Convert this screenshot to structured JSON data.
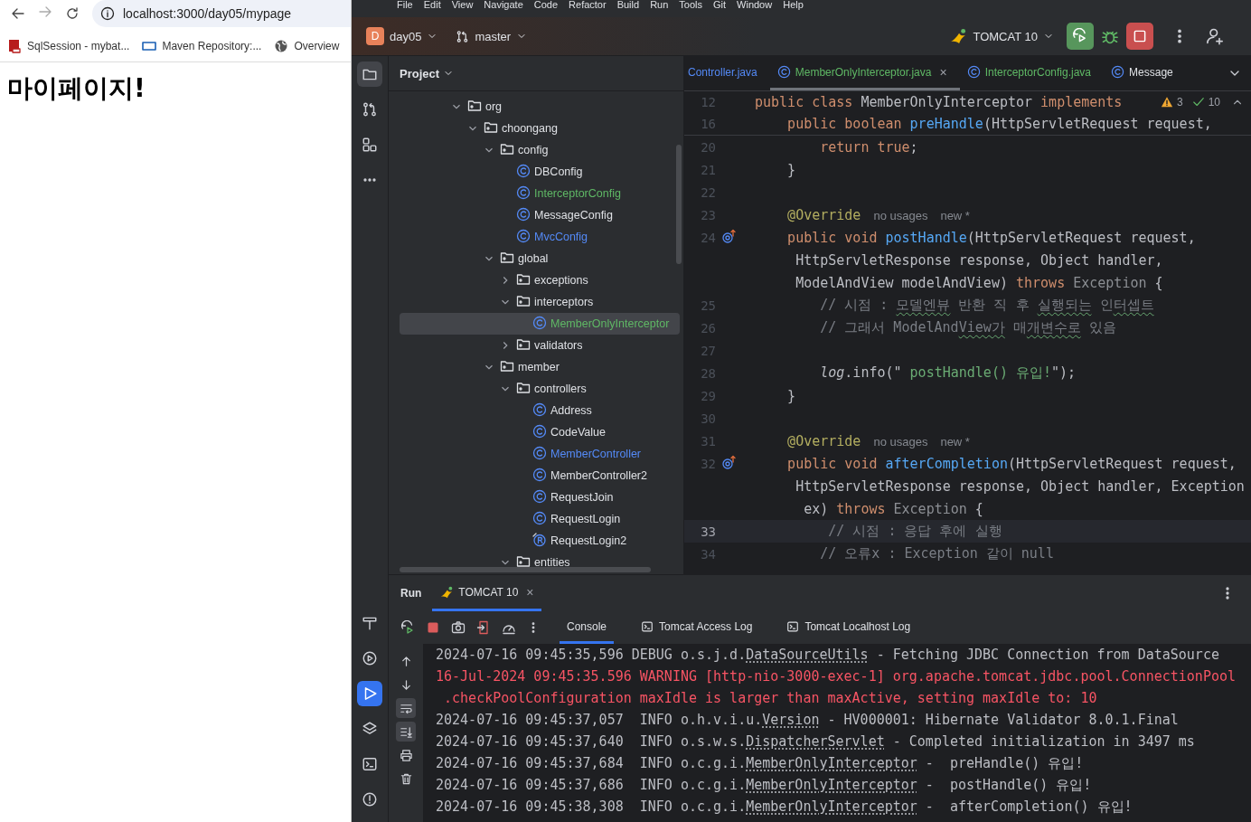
{
  "browser": {
    "url": "localhost:3000/day05/mypage",
    "bookmarks": [
      {
        "label": "SqlSession - mybat...",
        "kind": "book"
      },
      {
        "label": "Maven Repository:...",
        "kind": "maven"
      },
      {
        "label": "Overview",
        "kind": "globe"
      }
    ],
    "page_heading": "마이페이지!"
  },
  "ide": {
    "menu": [
      "File",
      "Edit",
      "View",
      "Navigate",
      "Code",
      "Refactor",
      "Build",
      "Run",
      "Tools",
      "Git",
      "Window",
      "Help"
    ],
    "toolbar": {
      "project_initial": "D",
      "project": "day05",
      "branch": "master",
      "run_config": "TOMCAT 10"
    },
    "tool_strip_top": [
      {
        "kind": "folder",
        "selected": true
      },
      {
        "kind": "pull-request",
        "selected": false
      },
      {
        "kind": "structure",
        "selected": false
      },
      {
        "kind": "more",
        "selected": false
      }
    ],
    "tool_strip_bottom": [
      {
        "kind": "build",
        "selected": false
      },
      {
        "kind": "services",
        "selected": false
      },
      {
        "kind": "run",
        "selected": true
      },
      {
        "kind": "layers",
        "selected": false
      },
      {
        "kind": "terminal",
        "selected": false
      },
      {
        "kind": "problems",
        "selected": false
      }
    ],
    "project_panel": {
      "title": "Project",
      "tree": [
        {
          "label": "org",
          "kind": "folder",
          "expanded": true,
          "selected": false,
          "color": "#dfe1e5",
          "children": [
            {
              "label": "choongang",
              "kind": "folder",
              "expanded": true,
              "selected": false,
              "color": "#dfe1e5",
              "children": [
                {
                  "label": "config",
                  "kind": "folder",
                  "expanded": true,
                  "selected": false,
                  "color": "#dfe1e5",
                  "children": [
                    {
                      "label": "DBConfig",
                      "kind": "class",
                      "selected": false,
                      "color": "#dfe1e5"
                    },
                    {
                      "label": "InterceptorConfig",
                      "kind": "class",
                      "selected": false,
                      "color": "#5fb865"
                    },
                    {
                      "label": "MessageConfig",
                      "kind": "class",
                      "selected": false,
                      "color": "#dfe1e5"
                    },
                    {
                      "label": "MvcConfig",
                      "kind": "class",
                      "selected": false,
                      "color": "#548af7"
                    }
                  ]
                },
                {
                  "label": "global",
                  "kind": "folder",
                  "expanded": true,
                  "selected": false,
                  "color": "#dfe1e5",
                  "children": [
                    {
                      "label": "exceptions",
                      "kind": "folder",
                      "expanded": false,
                      "selected": false,
                      "color": "#dfe1e5"
                    },
                    {
                      "label": "interceptors",
                      "kind": "folder",
                      "expanded": true,
                      "selected": false,
                      "color": "#dfe1e5",
                      "children": [
                        {
                          "label": "MemberOnlyInterceptor",
                          "kind": "class",
                          "selected": true,
                          "color": "#5fb865"
                        }
                      ]
                    },
                    {
                      "label": "validators",
                      "kind": "folder",
                      "expanded": false,
                      "selected": false,
                      "color": "#dfe1e5"
                    }
                  ]
                },
                {
                  "label": "member",
                  "kind": "folder",
                  "expanded": true,
                  "selected": false,
                  "color": "#dfe1e5",
                  "children": [
                    {
                      "label": "controllers",
                      "kind": "folder",
                      "expanded": true,
                      "selected": false,
                      "color": "#dfe1e5",
                      "children": [
                        {
                          "label": "Address",
                          "kind": "class",
                          "selected": false,
                          "color": "#dfe1e5"
                        },
                        {
                          "label": "CodeValue",
                          "kind": "class",
                          "selected": false,
                          "color": "#dfe1e5"
                        },
                        {
                          "label": "MemberController",
                          "kind": "class",
                          "selected": false,
                          "color": "#548af7"
                        },
                        {
                          "label": "MemberController2",
                          "kind": "class",
                          "selected": false,
                          "color": "#dfe1e5"
                        },
                        {
                          "label": "RequestJoin",
                          "kind": "class",
                          "selected": false,
                          "color": "#dfe1e5"
                        },
                        {
                          "label": "RequestLogin",
                          "kind": "class",
                          "selected": false,
                          "color": "#dfe1e5"
                        },
                        {
                          "label": "RequestLogin2",
                          "kind": "record",
                          "selected": false,
                          "color": "#dfe1e5"
                        }
                      ]
                    },
                    {
                      "label": "entities",
                      "kind": "folder",
                      "expanded": true,
                      "selected": false,
                      "color": "#dfe1e5"
                    }
                  ]
                }
              ]
            }
          ]
        }
      ]
    },
    "editor": {
      "tabs": [
        {
          "label": "Controller.java",
          "selected": false,
          "color": "#548af7",
          "icon": false
        },
        {
          "label": "MemberOnlyInterceptor.java",
          "selected": true,
          "color": "#5fb865",
          "icon": true,
          "close_glyph": "×"
        },
        {
          "label": "InterceptorConfig.java",
          "selected": false,
          "color": "#5fb865",
          "icon": true
        },
        {
          "label": "Message",
          "selected": false,
          "color": "#dfe1e5",
          "icon": true
        }
      ],
      "inspections": {
        "warnings": "3",
        "checks": "10"
      },
      "lines": [
        {
          "number": "12",
          "sticky": true,
          "current": false,
          "marker": false,
          "tokens": [
            {
              "kind": "kw",
              "text": "public class "
            },
            {
              "kind": "plain",
              "text": "MemberOnlyInterceptor "
            },
            {
              "kind": "kw",
              "text": "implements"
            }
          ]
        },
        {
          "number": "16",
          "sticky": true,
          "current": false,
          "marker": false,
          "tokens": [
            {
              "kind": "kw",
              "text": "    public boolean "
            },
            {
              "kind": "fn",
              "text": "preHandle"
            },
            {
              "kind": "plain",
              "text": "(HttpServletRequest request,"
            }
          ]
        },
        {
          "number": "20",
          "sticky": false,
          "current": false,
          "marker": false,
          "tokens": [
            {
              "kind": "kw",
              "text": "        return true"
            },
            {
              "kind": "plain",
              "text": ";"
            }
          ]
        },
        {
          "number": "21",
          "sticky": false,
          "current": false,
          "marker": false,
          "tokens": [
            {
              "kind": "plain",
              "text": "    }"
            }
          ]
        },
        {
          "number": "22",
          "sticky": false,
          "current": false,
          "marker": false
        },
        {
          "number": "23",
          "sticky": false,
          "current": false,
          "marker": false,
          "tokens": [
            {
              "kind": "annot",
              "text": "    @Override"
            },
            {
              "kind": "hint",
              "text": "no usages"
            },
            {
              "kind": "hint",
              "text": "new *"
            }
          ]
        },
        {
          "number": "24",
          "sticky": false,
          "current": false,
          "marker": true,
          "tokens": [
            {
              "kind": "kw",
              "text": "    public void "
            },
            {
              "kind": "fn",
              "text": "postHandle"
            },
            {
              "kind": "plain",
              "text": "(HttpServletRequest request,"
            }
          ]
        },
        {
          "sticky": false,
          "current": false,
          "marker": false,
          "tokens": [
            {
              "kind": "plain",
              "text": "     HttpServletResponse response, Object handler,"
            }
          ]
        },
        {
          "sticky": false,
          "current": false,
          "marker": false,
          "tokens": [
            {
              "kind": "plain",
              "text": "     ModelAndView modelAndView) "
            },
            {
              "kind": "kw",
              "text": "throws "
            },
            {
              "kind": "dim",
              "text": "Exception "
            },
            {
              "kind": "plain",
              "text": "{"
            }
          ]
        },
        {
          "number": "25",
          "sticky": false,
          "current": false,
          "marker": false,
          "tokens": [
            {
              "kind": "comment",
              "text": "        // 시점 : "
            },
            {
              "kind": "typo",
              "text": "모델엔뷰"
            },
            {
              "kind": "comment",
              "text": " 반환 직 후 "
            },
            {
              "kind": "typo",
              "text": "실행되는"
            },
            {
              "kind": "comment",
              "text": " 인"
            },
            {
              "kind": "typo",
              "text": "터셉트"
            }
          ]
        },
        {
          "number": "26",
          "sticky": false,
          "current": false,
          "marker": false,
          "tokens": [
            {
              "kind": "comment",
              "text": "        // 그래서 ModelAnd"
            },
            {
              "kind": "typo",
              "text": "View가"
            },
            {
              "kind": "comment",
              "text": " 매"
            },
            {
              "kind": "typo",
              "text": "개변수로"
            },
            {
              "kind": "comment",
              "text": " 있음"
            }
          ]
        },
        {
          "number": "27",
          "sticky": false,
          "current": false,
          "marker": false
        },
        {
          "number": "28",
          "sticky": false,
          "current": false,
          "marker": false,
          "tokens": [
            {
              "kind": "static",
              "text": "        log"
            },
            {
              "kind": "plain",
              "text": ".info(\""
            },
            {
              "kind": "str",
              "text": " postHandle() 유입!"
            },
            {
              "kind": "plain",
              "text": "\");"
            }
          ]
        },
        {
          "number": "29",
          "sticky": false,
          "current": false,
          "marker": false,
          "tokens": [
            {
              "kind": "plain",
              "text": "    }"
            }
          ]
        },
        {
          "number": "30",
          "sticky": false,
          "current": false,
          "marker": false
        },
        {
          "number": "31",
          "sticky": false,
          "current": false,
          "marker": false,
          "tokens": [
            {
              "kind": "annot",
              "text": "    @Override"
            },
            {
              "kind": "hint",
              "text": "no usages"
            },
            {
              "kind": "hint",
              "text": "new *"
            }
          ]
        },
        {
          "number": "32",
          "sticky": false,
          "current": false,
          "marker": true,
          "tokens": [
            {
              "kind": "kw",
              "text": "    public void "
            },
            {
              "kind": "fn",
              "text": "afterCompletion"
            },
            {
              "kind": "plain",
              "text": "(HttpServletRequest request,"
            }
          ]
        },
        {
          "sticky": false,
          "current": false,
          "marker": false,
          "tokens": [
            {
              "kind": "plain",
              "text": "     HttpServletResponse response, Object handler, Exception"
            }
          ]
        },
        {
          "sticky": false,
          "current": false,
          "marker": false,
          "tokens": [
            {
              "kind": "plain",
              "text": "      ex) "
            },
            {
              "kind": "kw",
              "text": "throws "
            },
            {
              "kind": "dim",
              "text": "Exception "
            },
            {
              "kind": "plain",
              "text": "{"
            }
          ]
        },
        {
          "number": "33",
          "sticky": false,
          "current": true,
          "marker": false,
          "tokens": [
            {
              "kind": "comment",
              "text": "         // 시점 : 응답 후에 실행"
            }
          ]
        },
        {
          "number": "34",
          "sticky": false,
          "current": false,
          "marker": false,
          "tokens": [
            {
              "kind": "comment",
              "text": "        // 오류x : Exception 같이 null"
            }
          ]
        }
      ]
    },
    "run_panel": {
      "title": "Run",
      "tabs": [
        {
          "label": "TOMCAT 10",
          "selected": true,
          "close_glyph": "×"
        }
      ],
      "subtabs": [
        {
          "label": "Console",
          "kind": "console",
          "selected": true
        },
        {
          "label": "Tomcat Access Log",
          "kind": "log",
          "selected": false
        },
        {
          "label": "Tomcat Localhost Log",
          "kind": "log",
          "selected": false
        }
      ],
      "gutter": [
        {
          "kind": "up",
          "selected": false
        },
        {
          "kind": "down",
          "selected": false
        },
        {
          "kind": "wrap",
          "selected": true
        },
        {
          "kind": "scroll-end",
          "selected": true
        },
        {
          "kind": "print",
          "selected": false
        },
        {
          "kind": "trash",
          "selected": false
        }
      ],
      "console": [
        {
          "kind": "info",
          "segments": [
            {
              "text": "2024-07-16 09:45:35,596 DEBUG o.s.j.d.",
              "link": false
            },
            {
              "text": "DataSourceUtils",
              "link": true
            },
            {
              "text": " - Fetching JDBC Connection from DataSource",
              "link": false
            }
          ]
        },
        {
          "kind": "warning",
          "segments": [
            {
              "text": "16-Jul-2024 09:45:35.596 WARNING [http-nio-3000-exec-1] org.apache.tomcat.jdbc.pool.ConnectionPool",
              "link": false
            }
          ]
        },
        {
          "kind": "warning",
          "segments": [
            {
              "text": " .checkPoolConfiguration maxIdle is larger than maxActive, setting maxIdle to: 10",
              "link": false
            }
          ]
        },
        {
          "kind": "info",
          "segments": [
            {
              "text": "2024-07-16 09:45:37,057  INFO o.h.v.i.u.",
              "link": false
            },
            {
              "text": "Version",
              "link": true
            },
            {
              "text": " - HV000001: Hibernate Validator 8.0.1.Final",
              "link": false
            }
          ]
        },
        {
          "kind": "info",
          "segments": [
            {
              "text": "2024-07-16 09:45:37,640  INFO o.s.w.s.",
              "link": false
            },
            {
              "text": "DispatcherServlet",
              "link": true
            },
            {
              "text": " - Completed initialization in 3497 ms",
              "link": false
            }
          ]
        },
        {
          "kind": "info",
          "segments": [
            {
              "text": "2024-07-16 09:45:37,684  INFO o.c.g.i.",
              "link": false
            },
            {
              "text": "MemberOnlyInterceptor",
              "link": true
            },
            {
              "text": " -  preHandle() 유입!",
              "link": false
            }
          ]
        },
        {
          "kind": "info",
          "segments": [
            {
              "text": "2024-07-16 09:45:37,686  INFO o.c.g.i.",
              "link": false
            },
            {
              "text": "MemberOnlyInterceptor",
              "link": true
            },
            {
              "text": " -  postHandle() 유입!",
              "link": false
            }
          ]
        },
        {
          "kind": "info",
          "segments": [
            {
              "text": "2024-07-16 09:45:38,308  INFO o.c.g.i.",
              "link": false
            },
            {
              "text": "MemberOnlyInterceptor",
              "link": true
            },
            {
              "text": " -  afterCompletion() 유입!",
              "link": false
            }
          ]
        }
      ]
    }
  }
}
